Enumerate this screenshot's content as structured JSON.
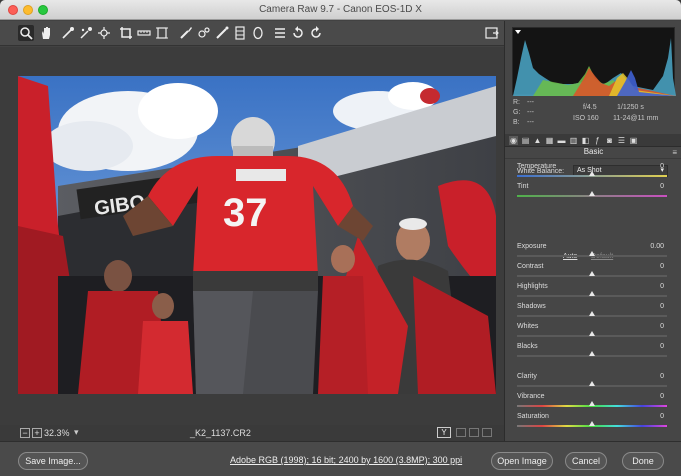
{
  "window": {
    "title": "Camera Raw 9.7  -  Canon EOS-1D X"
  },
  "toolbar": {
    "tools": [
      "zoom-icon",
      "hand-icon",
      "white-balance-icon",
      "color-sampler-icon",
      "targeted-adjustment-icon",
      "crop-icon",
      "straighten-icon",
      "transform-icon",
      "spot-removal-icon",
      "red-eye-icon",
      "adjustment-brush-icon",
      "graduated-filter-icon",
      "radial-filter-icon",
      "preferences-icon",
      "rotate-left-icon",
      "rotate-right-icon"
    ],
    "toggle_fullscreen_icon": "toggle-fullscreen-icon"
  },
  "status": {
    "zoom_value": "32.3%",
    "filename": "_K2_1137.CR2",
    "view_toggle_label": "Y"
  },
  "histogram_meta": {
    "r_label": "R:",
    "r_value": "---",
    "g_label": "G:",
    "g_value": "---",
    "b_label": "B:",
    "b_value": "---",
    "aperture": "f/4.5",
    "shutter": "1/1250 s",
    "iso": "ISO 160",
    "lens": "11-24@11 mm"
  },
  "panel": {
    "section_title": "Basic",
    "white_balance_label": "White Balance:",
    "white_balance_value": "As Shot",
    "auto_label": "Auto",
    "default_label": "Default",
    "sliders": [
      {
        "name": "temperature",
        "label": "Temperature",
        "value": "0",
        "level": 0.5
      },
      {
        "name": "tint",
        "label": "Tint",
        "value": "0",
        "level": 0.5
      },
      {
        "name": "exposure",
        "label": "Exposure",
        "value": "0.00",
        "level": 0.5
      },
      {
        "name": "contrast",
        "label": "Contrast",
        "value": "0",
        "level": 0.5
      },
      {
        "name": "highlights",
        "label": "Highlights",
        "value": "0",
        "level": 0.5
      },
      {
        "name": "shadows",
        "label": "Shadows",
        "value": "0",
        "level": 0.5
      },
      {
        "name": "whites",
        "label": "Whites",
        "value": "0",
        "level": 0.5
      },
      {
        "name": "blacks",
        "label": "Blacks",
        "value": "0",
        "level": 0.5
      },
      {
        "name": "clarity",
        "label": "Clarity",
        "value": "0",
        "level": 0.5
      },
      {
        "name": "vibrance",
        "label": "Vibrance",
        "value": "0",
        "level": 0.5
      },
      {
        "name": "saturation",
        "label": "Saturation",
        "value": "0",
        "level": 0.5
      }
    ]
  },
  "footer": {
    "save_label": "Save Image...",
    "workflow_text": "Adobe RGB (1998); 16 bit; 2400 by 1600 (3.8MP); 300 ppi",
    "open_label": "Open Image",
    "cancel_label": "Cancel",
    "done_label": "Done"
  },
  "photo": {
    "jersey_number": "37"
  },
  "colors": {
    "accent": "#d8262c",
    "panel_bg": "#464646",
    "toolbar_bg": "#4a4a4a"
  }
}
